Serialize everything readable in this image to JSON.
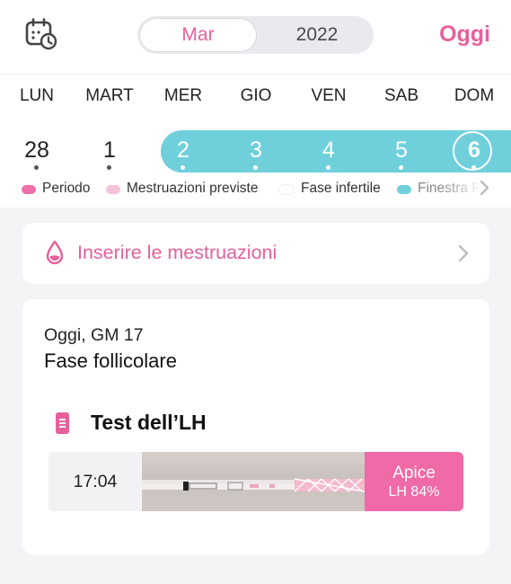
{
  "header": {
    "calendar_icon": "calendar-clock-icon",
    "month": "Mar",
    "year": "2022",
    "today_button": "Oggi"
  },
  "weekdays": [
    "LUN",
    "MART",
    "MER",
    "GIO",
    "VEN",
    "SAB",
    "DOM"
  ],
  "days": [
    "28",
    "1",
    "2",
    "3",
    "4",
    "5",
    "6"
  ],
  "legend": {
    "period": "Periodo",
    "expected": "Mestruazioni previste",
    "infertile": "Fase infertile",
    "fertile_window": "Finestra F"
  },
  "colors": {
    "accent": "#e5609c",
    "fertile": "#6fd0dc",
    "period": "#f06fa8",
    "expected": "#f5c2db"
  },
  "log_card": {
    "label": "Inserire le mestruazioni",
    "icon": "drop-icon"
  },
  "info": {
    "day_line": "Oggi, GM 17",
    "phase": "Fase follicolare",
    "lh_title": "Test dell’LH",
    "lh_icon": "test-strip-icon",
    "entry": {
      "time": "17:04",
      "result_label": "Apice",
      "result_value": "LH 84%"
    }
  }
}
